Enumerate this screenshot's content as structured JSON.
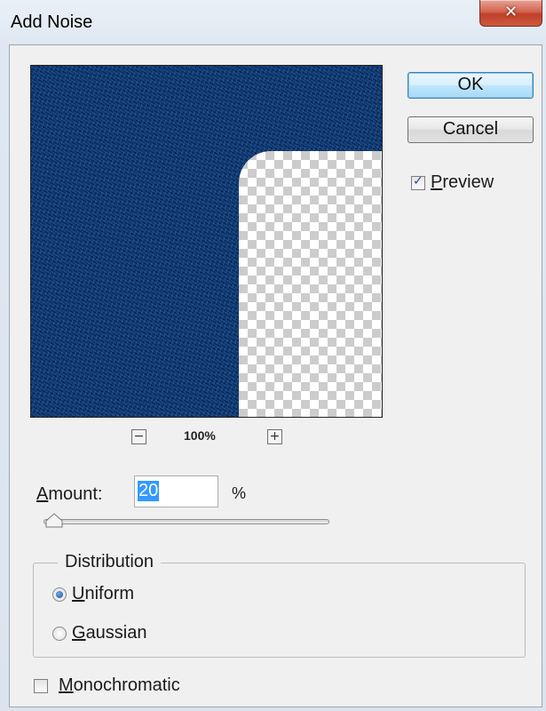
{
  "window": {
    "title": "Add Noise",
    "close_glyph": "✕"
  },
  "preview": {
    "zoom_out_glyph": "−",
    "zoom_in_glyph": "+",
    "zoom_level": "100%"
  },
  "buttons": {
    "ok_label": "OK",
    "cancel_label": "Cancel"
  },
  "preview_toggle": {
    "label_accel": "P",
    "label_rest": "review",
    "checked": true
  },
  "amount": {
    "label_accel": "A",
    "label_rest": "mount:",
    "value": "20",
    "unit": "%"
  },
  "distribution": {
    "legend": "Distribution",
    "uniform_accel": "U",
    "uniform_rest": "niform",
    "gaussian_accel": "G",
    "gaussian_rest": "aussian",
    "selected": "Uniform"
  },
  "monochromatic": {
    "label_accel": "M",
    "label_rest": "onochromatic",
    "checked": false
  },
  "colors": {
    "noise_base": "#123a78",
    "selection": "#3399ff"
  }
}
